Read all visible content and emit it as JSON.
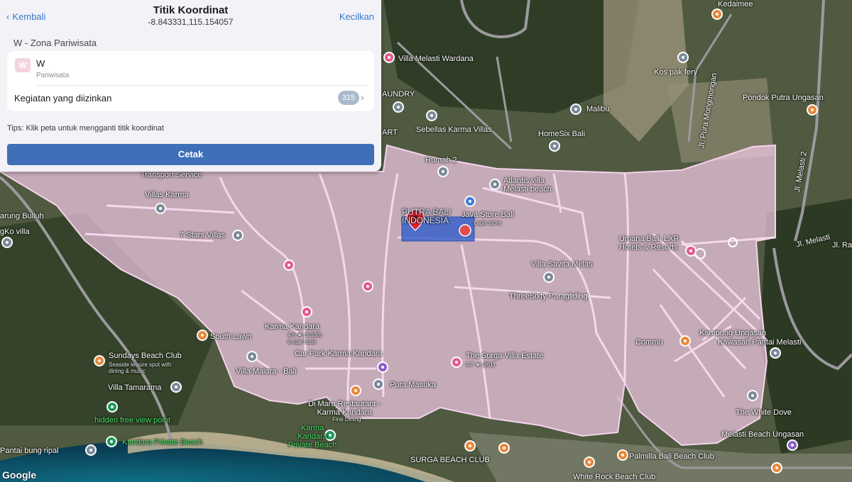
{
  "panel": {
    "back_label": "Kembali",
    "title": "Titik Koordinat",
    "coordinate": "-8.843331,115.154057",
    "minimize_label": "Kecilkan",
    "section_title": "W - Zona Pariwisata",
    "zone": {
      "badge": "W",
      "code": "W",
      "name": "Pariwisata"
    },
    "activities_label": "Kegiatan yang diizinkan",
    "activities_count": "315",
    "tips": "Tips: Klik peta untuk mengganti titik koordinat",
    "print_label": "Cetak"
  },
  "map": {
    "attribution": "Google",
    "zone_fill_color": "#f3c9e6",
    "zone_outline_color": "#f6d3ec",
    "marker_color": "#e1252c",
    "places": [
      {
        "name": "Kedaimee",
        "icon": "restaurant-icon"
      },
      {
        "name": "Villa Melasti Wardana",
        "icon": "hotel-icon"
      },
      {
        "name": "Kos pak fery",
        "icon": "place-icon"
      },
      {
        "name": "Pondok Putra Ungasan",
        "icon": "restaurant-icon"
      },
      {
        "name": "AUNDRY",
        "icon": ""
      },
      {
        "name": "Malibu",
        "icon": "place-icon"
      },
      {
        "name": "Sebellas Karma Villas",
        "icon": "place-icon"
      },
      {
        "name": "ART",
        "icon": ""
      },
      {
        "name": "HomeSix Bali",
        "icon": "place-icon"
      },
      {
        "name": "Transport Service",
        "icon": "place-icon"
      },
      {
        "name": "Rumah 2",
        "icon": "place-icon"
      },
      {
        "name": "Atlantis villa Melasti beach",
        "icon": "place-icon"
      },
      {
        "name": "Villas Karma",
        "icon": "place-icon"
      },
      {
        "name": "arung Bulluh",
        "icon": ""
      },
      {
        "name": "gKo villa",
        "icon": "place-icon"
      },
      {
        "name": "7 Stars Villas",
        "icon": "place-icon"
      },
      {
        "name": "Jl. Melasti 2",
        "icon": ""
      },
      {
        "name": "Jl. Melasti",
        "icon": ""
      },
      {
        "name": "Jl. Pura Mongmongan",
        "icon": ""
      },
      {
        "name": "Umana Bali, LXR Hotels & Resorts",
        "icon": "hotel-icon"
      },
      {
        "name": "Villa Savita Melas",
        "icon": "place-icon"
      },
      {
        "name": "ThreeSixty Paragliding",
        "icon": "place-icon"
      },
      {
        "name": "Karma Kandara",
        "icon": "hotel-icon"
      },
      {
        "name": "4.6 ★ (3,030)",
        "icon": ""
      },
      {
        "name": "5-star hotel",
        "icon": ""
      },
      {
        "name": "South Lawn",
        "icon": "restaurant-icon"
      },
      {
        "name": "Car Park Karma Kandara",
        "icon": "parking-icon"
      },
      {
        "name": "The Surga Villa Estate",
        "icon": "hotel-icon"
      },
      {
        "name": "4.7 ★ (261)",
        "icon": ""
      },
      {
        "name": "Kampung Ungasan",
        "icon": ""
      },
      {
        "name": "Kawasan Pantai Melasti",
        "icon": "place-icon"
      },
      {
        "name": "Commu",
        "icon": ""
      },
      {
        "name": "Sundays Beach Club",
        "icon": "restaurant-icon"
      },
      {
        "name": "Seaside leisure spot with dining & music",
        "icon": ""
      },
      {
        "name": "Villa Maiara - Bali",
        "icon": "place-icon"
      },
      {
        "name": "Villa Tamarama",
        "icon": "place-icon"
      },
      {
        "name": "Pura Masuka",
        "icon": "worship-icon"
      },
      {
        "name": "Di Mare Restaurant - Karma Kandara",
        "icon": "restaurant-icon"
      },
      {
        "name": "Fine Dining",
        "icon": ""
      },
      {
        "name": "hidden free view point",
        "icon": "viewpoint-icon"
      },
      {
        "name": "The White Dove",
        "icon": "place-icon"
      },
      {
        "name": "Melasti Beach Ungasan",
        "icon": "place-icon"
      },
      {
        "name": "Pantai bung ripal",
        "icon": "place-icon"
      },
      {
        "name": "Kandara Private Beach",
        "icon": "beach-icon"
      },
      {
        "name": "Karma Kandara Private Beach",
        "icon": "beach-icon"
      },
      {
        "name": "SURGA BEACH CLUB",
        "icon": "restaurant-icon"
      },
      {
        "name": "Palmilla Bali Beach Club",
        "icon": "restaurant-icon"
      },
      {
        "name": "White Rock Beach Club",
        "icon": "restaurant-icon"
      },
      {
        "name": "Jl. Ra",
        "icon": ""
      },
      {
        "name": "PUTRA BALI INDONESIA",
        "icon": ""
      },
      {
        "name": "Java Store Bali",
        "icon": "store-icon"
      },
      {
        "name": "Lapis store",
        "icon": ""
      }
    ]
  }
}
